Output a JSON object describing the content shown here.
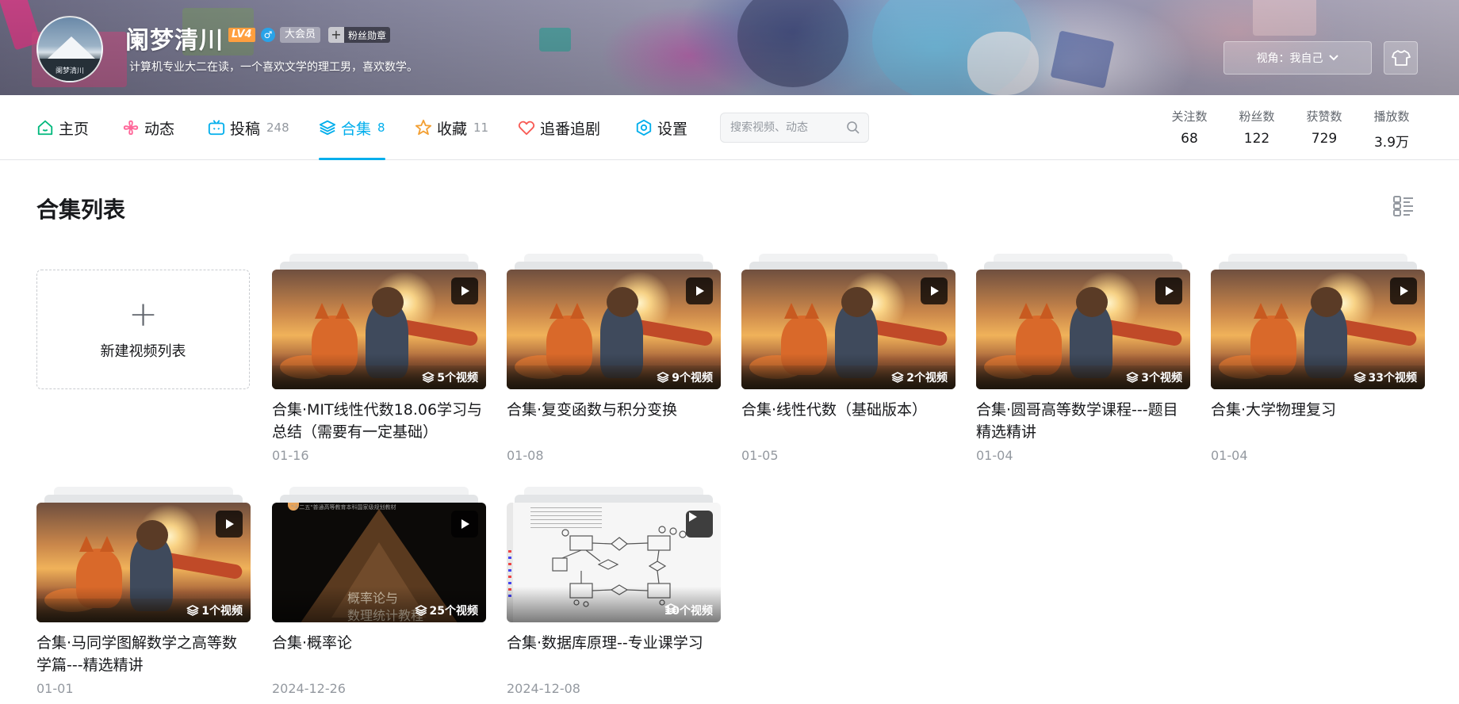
{
  "profile": {
    "name": "阑梦清川",
    "level": "LV4",
    "gender_symbol": "♂",
    "vip_label": "大会员",
    "fan_medal_plus": "+",
    "fan_medal_label": "粉丝勋章",
    "signature": "计算机专业大二在读，一个喜欢文学的理工男，喜欢数学。",
    "avatar_text": "阑梦清川"
  },
  "header_actions": {
    "view_label": "视角：我自己"
  },
  "nav": {
    "tabs": [
      {
        "label": "主页",
        "count": ""
      },
      {
        "label": "动态",
        "count": ""
      },
      {
        "label": "投稿",
        "count": "248"
      },
      {
        "label": "合集",
        "count": "8"
      },
      {
        "label": "收藏",
        "count": "11"
      },
      {
        "label": "追番追剧",
        "count": ""
      },
      {
        "label": "设置",
        "count": ""
      }
    ],
    "active_tab": "合集",
    "search_placeholder": "搜索视频、动态",
    "stats": [
      {
        "label": "关注数",
        "value": "68"
      },
      {
        "label": "粉丝数",
        "value": "122"
      },
      {
        "label": "获赞数",
        "value": "729"
      },
      {
        "label": "播放数",
        "value": "3.9万"
      }
    ]
  },
  "section": {
    "title": "合集列表",
    "new_list_plus": "+",
    "new_list_label": "新建视频列表"
  },
  "collections": [
    {
      "title": "合集·MIT线性代数18.06学习与总结（需要有一定基础）",
      "count": "5个视频",
      "date": "01-16",
      "thumb": "fox"
    },
    {
      "title": "合集·复变函数与积分变换",
      "count": "9个视频",
      "date": "01-08",
      "thumb": "fox"
    },
    {
      "title": "合集·线性代数（基础版本）",
      "count": "2个视频",
      "date": "01-05",
      "thumb": "fox"
    },
    {
      "title": "合集·圆哥高等数学课程---题目精选精讲",
      "count": "3个视频",
      "date": "01-04",
      "thumb": "fox"
    },
    {
      "title": "合集·大学物理复习",
      "count": "33个视频",
      "date": "01-04",
      "thumb": "fox"
    },
    {
      "title": "合集·马同学图解数学之高等数学篇---精选精讲",
      "count": "1个视频",
      "date": "01-01",
      "thumb": "fox"
    },
    {
      "title": "合集·概率论",
      "count": "25个视频",
      "date": "2024-12-26",
      "thumb": "probability",
      "thumb_text_1": "概率论与",
      "thumb_text_2": "数理统计教程",
      "thumb_header": "\"十二五\"普通高等教育本科国家级规划教材"
    },
    {
      "title": "合集·数据库原理--专业课学习",
      "count": "10个视频",
      "date": "2024-12-08",
      "thumb": "database"
    }
  ],
  "colors": {
    "accent": "#00aeec",
    "text_primary": "#18191c",
    "text_secondary": "#9499a0",
    "level_badge": "#ff9f3f",
    "gender_badge": "#29a3e8"
  }
}
